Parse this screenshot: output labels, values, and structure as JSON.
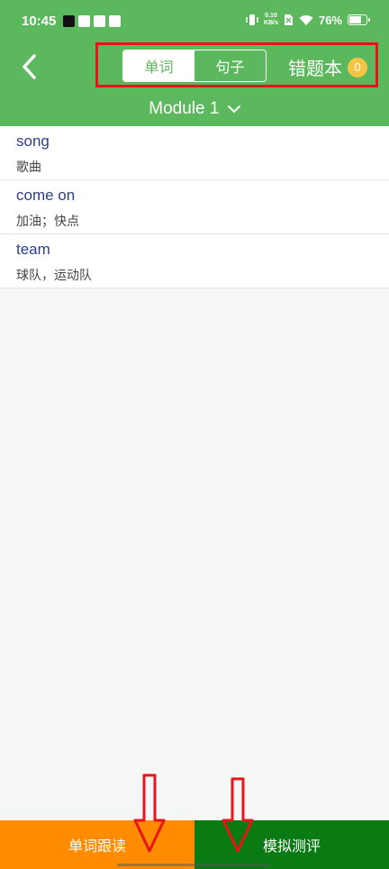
{
  "status_bar": {
    "time": "10:45",
    "net_speed_value": "0.10",
    "net_speed_unit": "KB/s",
    "battery": "76%",
    "battery_level": 0.76
  },
  "header": {
    "back_icon": "chevron-left-icon",
    "tabs": [
      {
        "label": "单词",
        "active": true
      },
      {
        "label": "句子",
        "active": false
      }
    ],
    "wrong_book_label": "错题本",
    "wrong_book_count": "0",
    "module_label": "Module 1"
  },
  "items": [
    {
      "word": "song",
      "meaning": "歌曲"
    },
    {
      "word": "come on",
      "meaning": "加油；快点"
    },
    {
      "word": "team",
      "meaning": "球队，运动队"
    }
  ],
  "bottom": {
    "follow_label": "单词跟读",
    "eval_label": "模拟测评"
  },
  "colors": {
    "header": "#5cb85c",
    "follow": "#ff8c00",
    "eval": "#0a7a12",
    "highlight": "#e8141a",
    "badge": "#f4c542"
  }
}
